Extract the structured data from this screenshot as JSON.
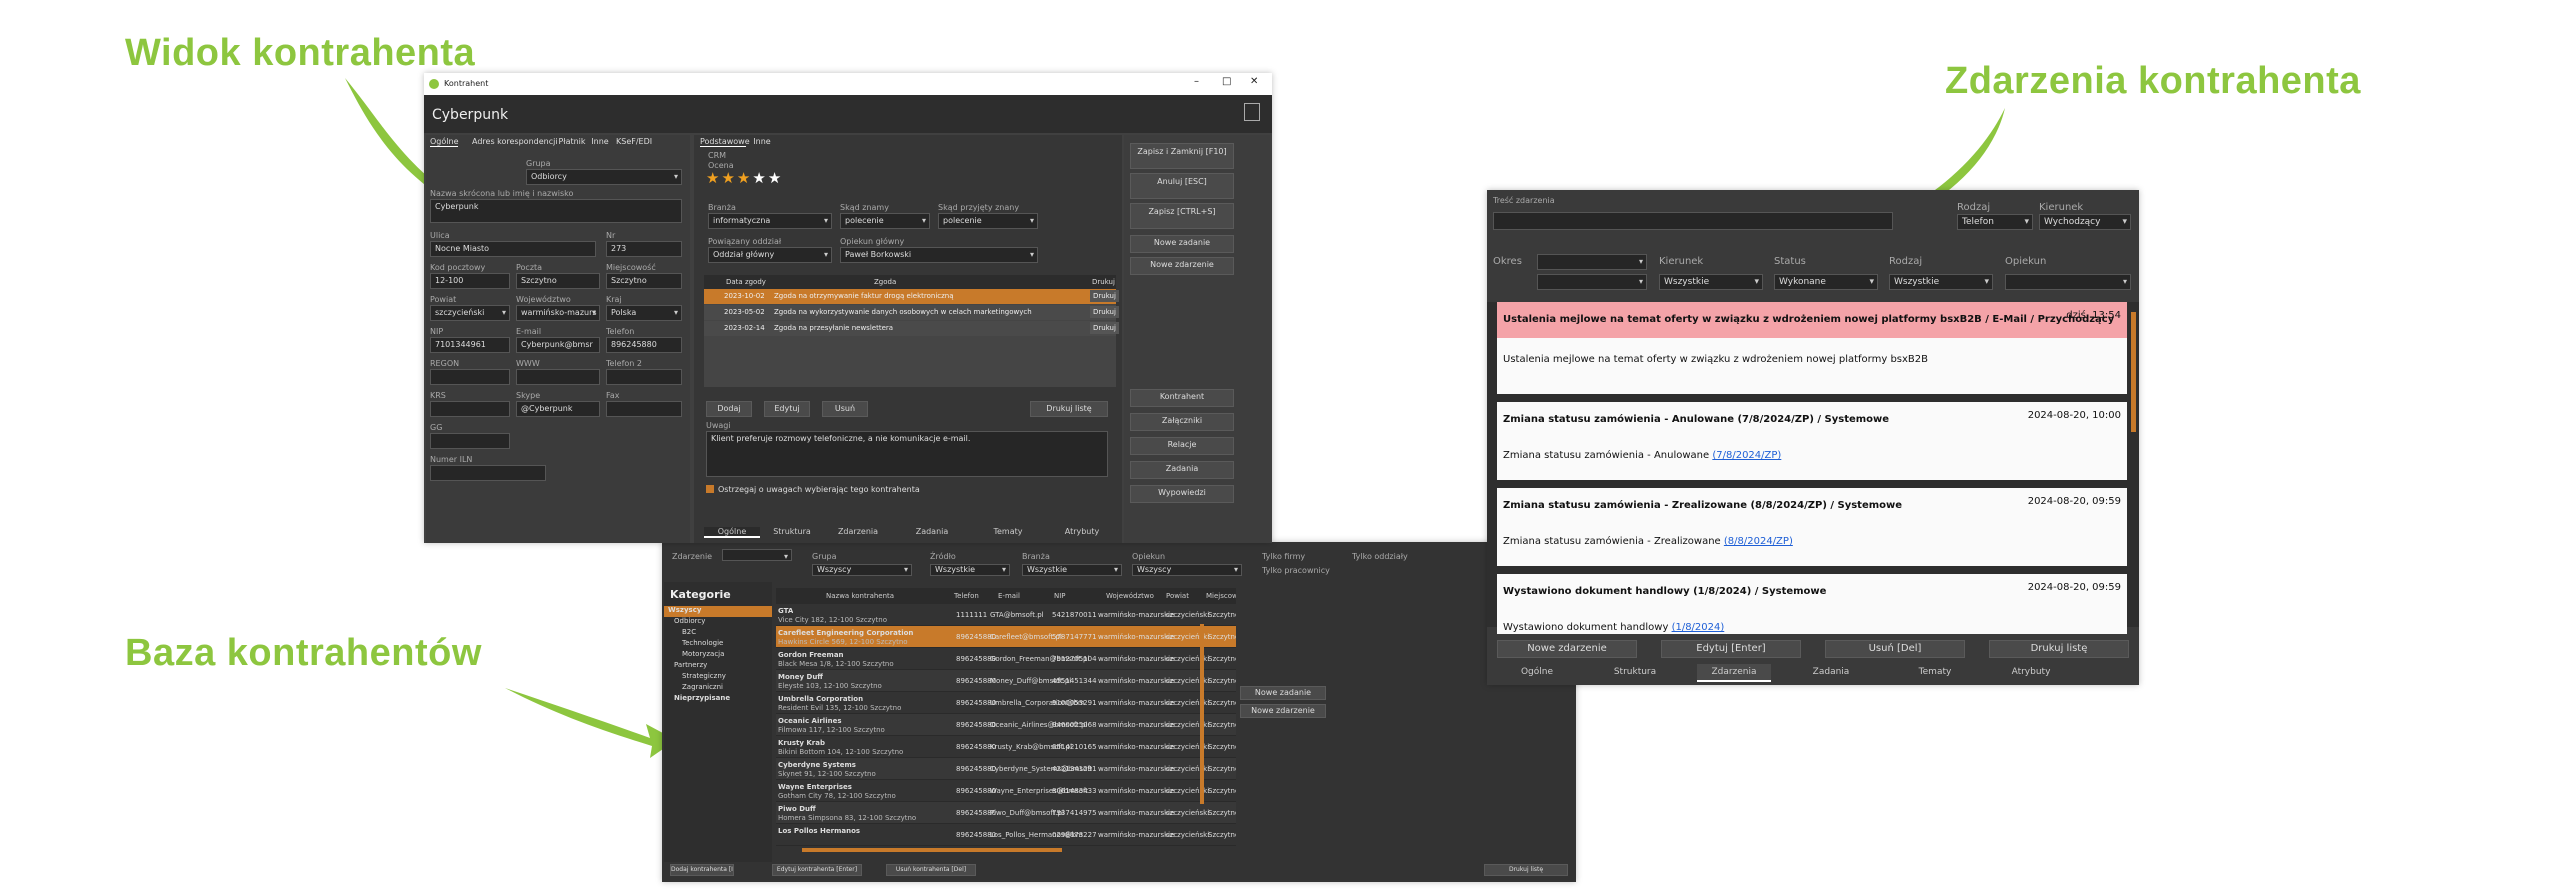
{
  "captions": {
    "detail": "Widok kontrahenta",
    "events": "Zdarzenia kontrahenta",
    "base": "Baza kontrahentów"
  },
  "detail": {
    "window_title": "Kontrahent",
    "name": "Cyberpunk",
    "left_tabs": [
      "Ogólne",
      "Adres korespondencji",
      "Płatnik",
      "Inne",
      "KSeF/EDI"
    ],
    "group_label": "Grupa",
    "group_value": "Odbiorcy",
    "short_name_label": "Nazwa skrócona lub imię i nazwisko",
    "short_name_value": "Cyberpunk",
    "street_label": "Ulica",
    "street_value": "Nocne Miasto",
    "no_label": "Nr",
    "no_value": "273",
    "zip_label": "Kod pocztowy",
    "zip_value": "12-100",
    "post_label": "Poczta",
    "post_value": "Szczytno",
    "city_label": "Miejscowość",
    "city_value": "Szczytno",
    "county_label": "Powiat",
    "county_value": "szczycieński",
    "voiv_label": "Województwo",
    "voiv_value": "warmińsko-mazurs",
    "country_label": "Kraj",
    "country_value": "Polska",
    "nip_label": "NIP",
    "nip_value": "7101344961",
    "email_label": "E-mail",
    "email_value": "Cyberpunk@bmsr",
    "phone_label": "Telefon",
    "phone_value": "896245880",
    "regon_label": "REGON",
    "www_label": "WWW",
    "phone2_label": "Telefon 2",
    "krs_label": "KRS",
    "skype_label": "Skype",
    "skype_value": "@Cyberpunk",
    "fax_label": "Fax",
    "gg_label": "GG",
    "iln_label": "Numer ILN",
    "right_tabs": [
      "Podstawowe",
      "Inne"
    ],
    "crm_label": "CRM",
    "rating_label": "Ocena",
    "rating_value": 3,
    "rating_max": 5,
    "industry_label": "Branża",
    "industry_value": "informatyczna",
    "source_label": "Skąd znamy",
    "source_value": "polecenie",
    "source2_label": "Skąd przyjęty znany",
    "source2_value": "polecenie",
    "branch_label": "Powiązany oddział",
    "branch_value": "Oddział główny",
    "keeper_label": "Opiekun główny",
    "keeper_value": "Paweł Borkowski",
    "consents": {
      "headers": [
        "Data zgody",
        "Zgoda",
        "Drukuj"
      ],
      "rows": [
        {
          "date": "2023-10-02",
          "text": "Zgoda na otrzymywanie faktur drogą elektroniczną",
          "btn": "Drukuj"
        },
        {
          "date": "2023-05-02",
          "text": "Zgoda na wykorzystywanie danych osobowych w celach marketingowych",
          "btn": "Drukuj"
        },
        {
          "date": "2023-02-14",
          "text": "Zgoda na przesyłanie newslettera",
          "btn": "Drukuj"
        }
      ]
    },
    "add_btn": "Dodaj",
    "edit_btn": "Edytuj",
    "del_btn": "Usuń",
    "print_list_btn": "Drukuj listę",
    "notes_label": "Uwagi",
    "notes_value": "Klient preferuje rozmowy telefoniczne, a nie komunikacje e-mail.",
    "notes_check": "Ostrzegaj o uwagach wybierając tego kontrahenta",
    "bottom_tabs": [
      "Ogólne",
      "Struktura",
      "Zdarzenia",
      "Zadania",
      "Tematy",
      "Atrybuty"
    ],
    "side_buttons": [
      "Zapisz i Zamknij [F10]",
      "Anuluj [ESC]",
      "Zapisz [CTRL+S]",
      "Nowe zadanie",
      "Nowe zdarzenie"
    ],
    "side_buttons2": [
      "Kontrahent",
      "Załączniki",
      "Relacje",
      "Zadania",
      "Wypowiedzi"
    ]
  },
  "events": {
    "content_label": "Treść zdarzenia",
    "type_label": "Rodzaj",
    "type_value": "Telefon",
    "dir_label": "Kierunek",
    "dir_value": "Wychodzący",
    "period_label": "Okres",
    "dir2_label": "Kierunek",
    "dir2_value": "Wszystkie",
    "status_label": "Status",
    "status_value": "Wykonane",
    "type2_label": "Rodzaj",
    "type2_value": "Wszystkie",
    "keeper_label": "Opiekun",
    "cards": [
      {
        "title": "Ustalenia mejlowe na temat oferty w związku z wdrożeniem nowej platformy bsxB2B / E-Mail / Przychodzący",
        "date": "dziś, 13:54",
        "body": "Ustalenia mejlowe na temat oferty w związku z wdrożeniem nowej platformy bsxB2B",
        "link": ""
      },
      {
        "title": "Zmiana statusu zamówienia - Anulowane (7/8/2024/ZP) / Systemowe",
        "date": "2024-08-20, 10:00",
        "body": "Zmiana statusu zamówienia - Anulowane",
        "link": "(7/8/2024/ZP)"
      },
      {
        "title": "Zmiana statusu zamówienia - Zrealizowane (8/8/2024/ZP) / Systemowe",
        "date": "2024-08-20, 09:59",
        "body": "Zmiana statusu zamówienia - Zrealizowane",
        "link": "(8/8/2024/ZP)"
      },
      {
        "title": "Wystawiono dokument handlowy (1/8/2024) / Systemowe",
        "date": "2024-08-20, 09:59",
        "body": "Wystawiono dokument handlowy",
        "link": "(1/8/2024)"
      }
    ],
    "buttons": [
      "Nowe zdarzenie",
      "Edytuj [Enter]",
      "Usuń [Del]",
      "Drukuj listę"
    ],
    "tabs": [
      "Ogólne",
      "Struktura",
      "Zdarzenia",
      "Zadania",
      "Tematy",
      "Atrybuty"
    ]
  },
  "base": {
    "filter_labels": {
      "zdarzenie": "Zdarzenie",
      "grupa": "Grupa",
      "zrodlo": "Źródło",
      "branza": "Branża",
      "opiekun": "Opiekun",
      "firmy": "Tylko firmy",
      "odd": "Tylko oddziały",
      "prac": "Tylko pracownicy"
    },
    "filter_values": {
      "grupa": "Wszyscy",
      "zrodlo": "Wszystkie",
      "branza": "Wszystkie",
      "opiekun": "Wszyscy"
    },
    "categories_title": "Kategorie",
    "categories": [
      "Wszyscy",
      "Odbiorcy",
      "B2C",
      "Technologie",
      "Motoryzacja",
      "Partnerzy",
      "Strategiczny",
      "Zagraniczni",
      "Nieprzypisane"
    ],
    "headers": [
      "Nazwa kontrahenta",
      "Telefon",
      "E-mail",
      "NIP",
      "Województwo",
      "Powiat",
      "Miejscowość"
    ],
    "rows": [
      {
        "name": "GTA",
        "addr": "Vice City 182, 12-100 Szczytno",
        "tel": "1111111",
        "mail": "GTA@bmsoft.pl",
        "nip": "5421870011",
        "woj": "warmińsko-mazurskie",
        "pow": "szczycieński",
        "city": "Szczytno"
      },
      {
        "name": "Carefleet Engineering Corporation",
        "addr": "Hawkins Circle 569, 12-100 Szczytno",
        "tel": "896245880",
        "mail": "Carefleet@bmsoft.pl",
        "nip": "5787147771",
        "woj": "warmińsko-mazurskie",
        "pow": "szczycieński",
        "city": "Szczytno"
      },
      {
        "name": "Gordon Freeman",
        "addr": "Black Mesa 1/8, 12-100 Szczytno",
        "tel": "896245880",
        "mail": "Gordon_Freeman@bmsoft.pl",
        "nip": "7912705104",
        "woj": "warmińsko-mazurskie",
        "pow": "szczycieński",
        "city": "Szczytno"
      },
      {
        "name": "Money Duff",
        "addr": "Eleyste 103, 12-100 Szczytno",
        "tel": "896245880",
        "mail": "Money_Duff@bmsoft.pl",
        "nip": "4551451344",
        "woj": "warmińsko-mazurskie",
        "pow": "szczycieński",
        "city": "Szczytno"
      },
      {
        "name": "Umbrella Corporation",
        "addr": "Resident Evil 135, 12-100 Szczytno",
        "tel": "896245880",
        "mail": "Umbrella_Corporation@bm",
        "nip": "9100053291",
        "woj": "warmińsko-mazurskie",
        "pow": "szczycieński",
        "city": "Szczytno"
      },
      {
        "name": "Oceanic Airlines",
        "addr": "Filmowa 117, 12-100 Szczytno",
        "tel": "896245880",
        "mail": "Oceanic_Airlines@bmsoft.pl",
        "nip": "9460025068",
        "woj": "warmińsko-mazurskie",
        "pow": "szczycieński",
        "city": "Szczytno"
      },
      {
        "name": "Krusty Krab",
        "addr": "Bikini Bottom 104, 12-100 Szczytno",
        "tel": "896245880",
        "mail": "Krusty_Krab@bmsoft.pl",
        "nip": "6514210165",
        "woj": "warmińsko-mazurskie",
        "pow": "szczycieński",
        "city": "Szczytno"
      },
      {
        "name": "Cyberdyne Systems",
        "addr": "Skynet 91, 12-100 Szczytno",
        "tel": "896245880",
        "mail": "Cyberdyne_Systems@bmsoft",
        "nip": "4221341291",
        "woj": "warmińsko-mazurskie",
        "pow": "szczycieński",
        "city": "Szczytno"
      },
      {
        "name": "Wayne Enterprises",
        "addr": "Gotham City 78, 12-100 Szczytno",
        "tel": "896245880",
        "mail": "Wayne_Enterprises@bmsoft",
        "nip": "8061483433",
        "woj": "warmińsko-mazurskie",
        "pow": "szczycieński",
        "city": "Szczytno"
      },
      {
        "name": "Piwo Duff",
        "addr": "Homera Simpsona 83, 12-100 Szczytno",
        "tel": "896245880",
        "mail": "Piwo_Duff@bmsoft.pl",
        "nip": "7937414975",
        "woj": "warmińsko-mazurskie",
        "pow": "szczycieński",
        "city": "Szczytno"
      },
      {
        "name": "Los Pollos Hermanos",
        "addr": "",
        "tel": "896245880",
        "mail": "Los_Pollos_Hermanos@bm",
        "nip": "0298673227",
        "woj": "warmińsko-mazurskie",
        "pow": "szczycieński",
        "city": "Szczytno"
      }
    ],
    "bottom_buttons": [
      "Dodaj kontrahenta [Ins]",
      "Edytuj kontrahenta [Enter]",
      "Usuń kontrahenta [Del]",
      "Drukuj listę"
    ],
    "side_buttons": [
      "Nowe zadanie",
      "Nowe zdarzenie"
    ]
  }
}
